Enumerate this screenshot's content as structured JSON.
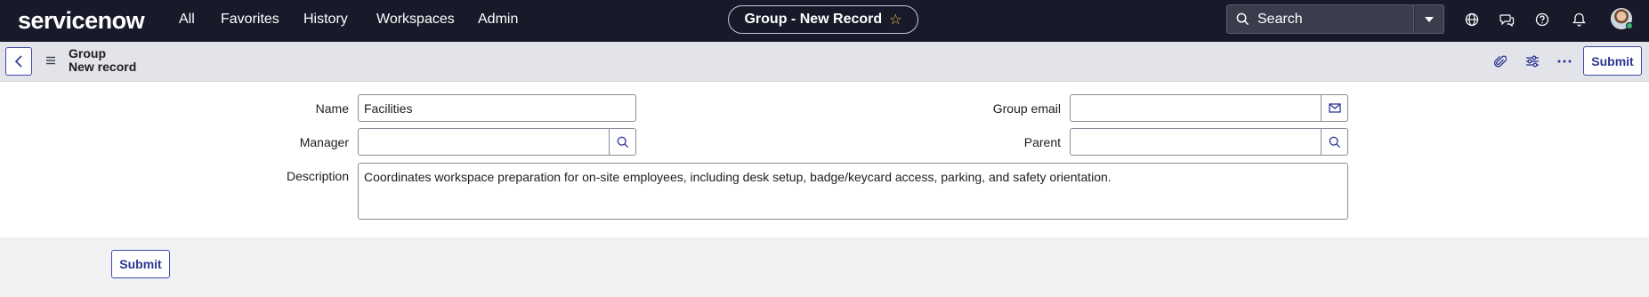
{
  "nav": {
    "logo": "servicenow",
    "items": [
      "All",
      "Favorites",
      "History",
      "Workspaces",
      "Admin"
    ],
    "record_pill": "Group - New Record",
    "search_placeholder": "Search"
  },
  "header": {
    "table_name": "Group",
    "record_status": "New record",
    "submit_label": "Submit"
  },
  "form": {
    "name_label": "Name",
    "name_value": "Facilities",
    "manager_label": "Manager",
    "manager_value": "",
    "description_label": "Description",
    "description_value": "Coordinates workspace preparation for on-site employees, including desk setup, badge/keycard access, parking, and safety orientation.",
    "group_email_label": "Group email",
    "group_email_value": "",
    "parent_label": "Parent",
    "parent_value": ""
  },
  "footer": {
    "submit_label": "Submit"
  },
  "colors": {
    "nav_bg": "#181a2a",
    "accent": "#3e49a8",
    "star": "#f5c23a"
  }
}
